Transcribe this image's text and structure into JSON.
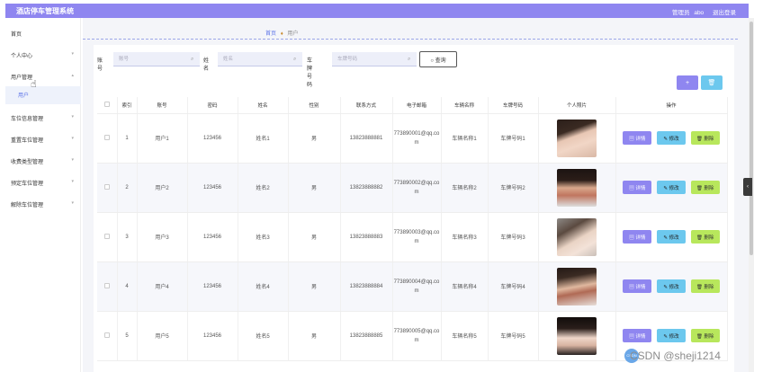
{
  "header": {
    "title": "酒店停车管理系统",
    "role": "管理员",
    "user": "abo",
    "logout": "退出登录"
  },
  "sidebar": {
    "items": [
      {
        "label": "首页",
        "has_chevron": false
      },
      {
        "label": "个人中心",
        "has_chevron": true
      },
      {
        "label": "用户管理",
        "has_chevron": true
      },
      {
        "label": "用户",
        "has_chevron": false
      },
      {
        "label": "车位信息管理",
        "has_chevron": true
      },
      {
        "label": "重置车位管理",
        "has_chevron": true
      },
      {
        "label": "收费类型管理",
        "has_chevron": true
      },
      {
        "label": "预定车位管理",
        "has_chevron": true
      },
      {
        "label": "解除车位管理",
        "has_chevron": true
      }
    ]
  },
  "breadcrumb": {
    "home": "首页",
    "current": "用户"
  },
  "search": {
    "account_label": "账号",
    "account_placeholder": "账号",
    "name_label": "姓名",
    "name_placeholder": "姓名",
    "plate_label": "车牌号码",
    "plate_placeholder": "车牌号码",
    "query_button": "查询"
  },
  "toolbar": {
    "add": "+",
    "delete": "🗑"
  },
  "table": {
    "columns": [
      "索引",
      "账号",
      "密码",
      "姓名",
      "性别",
      "联系方式",
      "电子邮箱",
      "车辆名称",
      "车牌号码",
      "个人照片",
      "操作"
    ],
    "rows": [
      {
        "index": "1",
        "account": "用户1",
        "password": "123456",
        "name": "姓名1",
        "gender": "男",
        "phone": "13823888881",
        "email": "773890001@qq.com",
        "vehicle": "车辆名称1",
        "plate": "车牌号码1"
      },
      {
        "index": "2",
        "account": "用户2",
        "password": "123456",
        "name": "姓名2",
        "gender": "男",
        "phone": "13823888882",
        "email": "773890002@qq.com",
        "vehicle": "车辆名称2",
        "plate": "车牌号码2"
      },
      {
        "index": "3",
        "account": "用户3",
        "password": "123456",
        "name": "姓名3",
        "gender": "男",
        "phone": "13823888883",
        "email": "773890003@qq.com",
        "vehicle": "车辆名称3",
        "plate": "车牌号码3"
      },
      {
        "index": "4",
        "account": "用户4",
        "password": "123456",
        "name": "姓名4",
        "gender": "男",
        "phone": "13823888884",
        "email": "773890004@qq.com",
        "vehicle": "车辆名称4",
        "plate": "车牌号码4"
      },
      {
        "index": "5",
        "account": "用户5",
        "password": "123456",
        "name": "姓名5",
        "gender": "男",
        "phone": "13823888885",
        "email": "773890005@qq.com",
        "vehicle": "车辆名称5",
        "plate": "车牌号码5"
      }
    ],
    "actions": {
      "detail": "详情",
      "edit": "修改",
      "delete": "删除"
    }
  },
  "watermark": {
    "text": "CSDN @sheji1214"
  },
  "colors": {
    "accent": "#8f86f0",
    "edit": "#6cc8ee",
    "delete": "#b8e75c"
  }
}
